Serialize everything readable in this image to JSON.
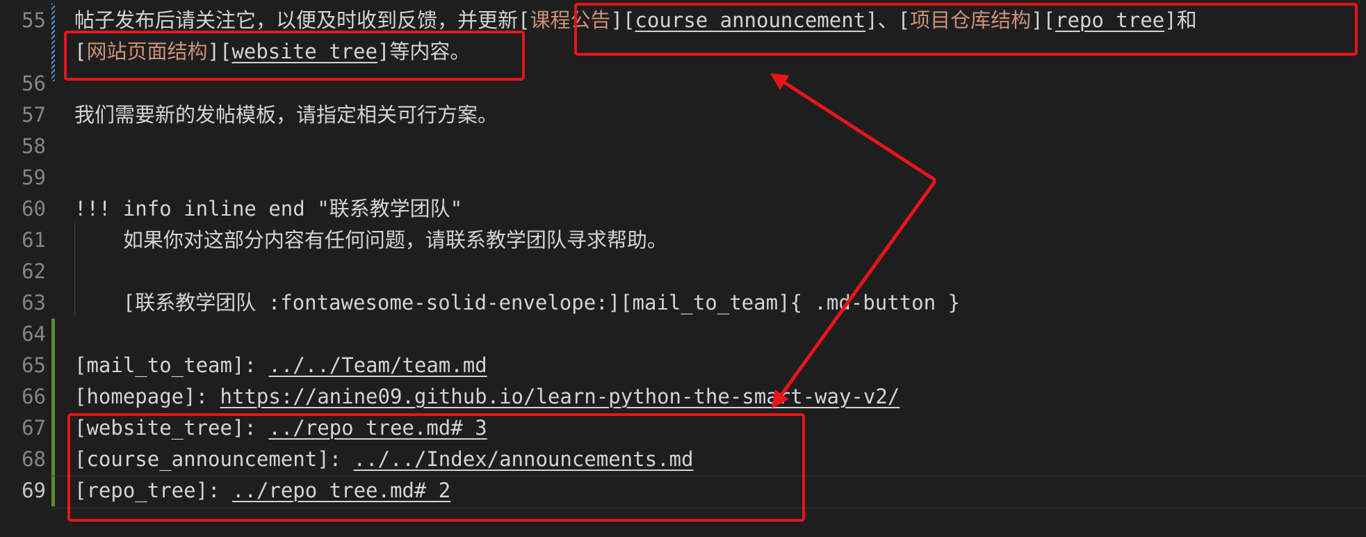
{
  "editor": {
    "lines": [
      {
        "n": "55",
        "segs": [
          {
            "t": "帖子发布后请关注它，以便及时收到反馈，并更新["
          },
          {
            "t": "课程公告",
            "c": "lt"
          },
          {
            "t": "]["
          },
          {
            "t": "course_announcement",
            "c": "link"
          },
          {
            "t": "]、["
          },
          {
            "t": "项目仓库结构",
            "c": "lt"
          },
          {
            "t": "]["
          },
          {
            "t": "repo_tree",
            "c": "link"
          },
          {
            "t": "]和"
          }
        ]
      },
      {
        "n": "",
        "segs": [
          {
            "t": "["
          },
          {
            "t": "网站页面结构",
            "c": "lt"
          },
          {
            "t": "]["
          },
          {
            "t": "website_tree",
            "c": "link"
          },
          {
            "t": "]等内容。"
          }
        ]
      },
      {
        "n": "56",
        "segs": []
      },
      {
        "n": "57",
        "segs": [
          {
            "t": "我们需要新的发帖模板，请指定相关可行方案。"
          }
        ]
      },
      {
        "n": "58",
        "segs": []
      },
      {
        "n": "59",
        "segs": []
      },
      {
        "n": "60",
        "segs": [
          {
            "t": "!!! info inline end \"联系教学团队\""
          }
        ]
      },
      {
        "n": "61",
        "segs": [
          {
            "t": "    如果你对这部分内容有任何问题，请联系教学团队寻求帮助。"
          }
        ]
      },
      {
        "n": "62",
        "segs": []
      },
      {
        "n": "63",
        "segs": [
          {
            "t": "    [联系教学团队 :fontawesome-solid-envelope:][mail_to_team]{ .md-button }"
          }
        ]
      },
      {
        "n": "64",
        "segs": []
      },
      {
        "n": "65",
        "segs": [
          {
            "t": "[mail_to_team]: "
          },
          {
            "t": "../../Team/team.md",
            "c": "link"
          }
        ]
      },
      {
        "n": "66",
        "segs": [
          {
            "t": "[homepage]: "
          },
          {
            "t": "https://anine09.github.io/learn-python-the-smart-way-v2/",
            "c": "link"
          }
        ]
      },
      {
        "n": "67",
        "segs": [
          {
            "t": "[website_tree]: "
          },
          {
            "t": "../repo_tree.md#_3",
            "c": "link"
          }
        ]
      },
      {
        "n": "68",
        "segs": [
          {
            "t": "[course_announcement]: "
          },
          {
            "t": "../../Index/announcements.md",
            "c": "link"
          }
        ]
      },
      {
        "n": "69",
        "segs": [
          {
            "t": "[repo_tree]: "
          },
          {
            "t": "../repo_tree.md#_2",
            "c": "link"
          }
        ],
        "current": true
      }
    ]
  },
  "colors": {
    "background": "#1e1e1e",
    "text": "#d4d4d4",
    "link_text": "#ce9178",
    "line_number": "#858585",
    "annotation": "#e8141a",
    "gutter_modified": "#4a9dd6",
    "gutter_added": "#5b8e2a"
  }
}
